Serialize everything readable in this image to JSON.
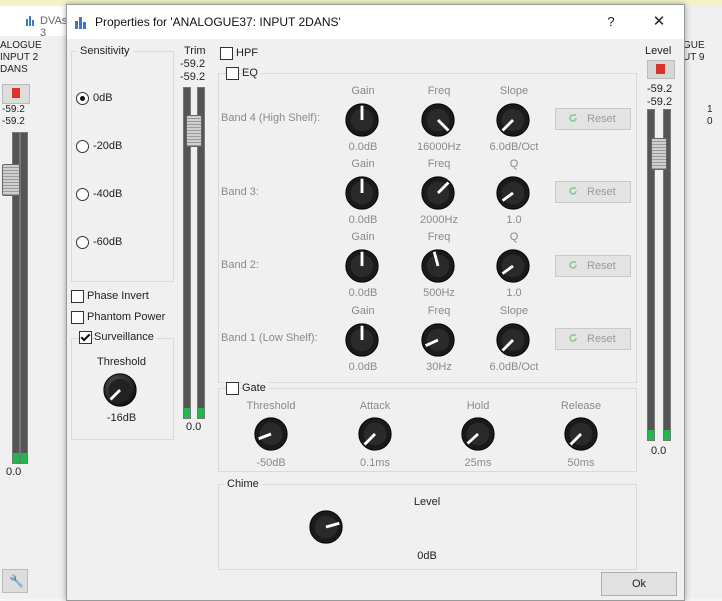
{
  "background": {
    "left_window": {
      "title": "DVAs 3",
      "name_lines": [
        "ALOGUE",
        "INPUT 2",
        "DANS"
      ],
      "values": [
        "-59.2",
        "-59.2"
      ],
      "bottom_value": "0.0"
    },
    "right_window": {
      "name_lines": [
        "GUE",
        "UT 9"
      ],
      "values": [
        "1",
        "0"
      ]
    }
  },
  "dialog": {
    "title": "Properties for 'ANALOGUE37: INPUT 2DANS'",
    "help_label": "?",
    "close_label": "✕",
    "ok_label": "Ok"
  },
  "sensitivity": {
    "label": "Sensitivity",
    "options": [
      "0dB",
      "-20dB",
      "-40dB",
      "-60dB"
    ],
    "selected": "0dB"
  },
  "options": {
    "phase_invert": {
      "label": "Phase Invert",
      "checked": false
    },
    "phantom_power": {
      "label": "Phantom Power",
      "checked": false
    },
    "surveillance": {
      "label": "Surveillance",
      "checked": true
    }
  },
  "threshold": {
    "label": "Threshold",
    "value": "-16dB"
  },
  "trim": {
    "label": "Trim",
    "values": [
      "-59.2",
      "-59.2"
    ],
    "bottom_value": "0.0"
  },
  "level": {
    "label": "Level",
    "values": [
      "-59.2",
      "-59.2"
    ],
    "bottom_value": "0.0"
  },
  "hpf": {
    "label": "HPF",
    "checked": false
  },
  "eq": {
    "label": "EQ",
    "checked": false,
    "reset_label": "Reset",
    "bands": [
      {
        "name": "Band 4 (High Shelf):",
        "p1": "Gain",
        "v1": "0.0dB",
        "p2": "Freq",
        "v2": "16000Hz",
        "p3": "Slope",
        "v3": "6.0dB/Oct"
      },
      {
        "name": "Band 3:",
        "p1": "Gain",
        "v1": "0.0dB",
        "p2": "Freq",
        "v2": "2000Hz",
        "p3": "Q",
        "v3": "1.0"
      },
      {
        "name": "Band 2:",
        "p1": "Gain",
        "v1": "0.0dB",
        "p2": "Freq",
        "v2": "500Hz",
        "p3": "Q",
        "v3": "1.0"
      },
      {
        "name": "Band 1 (Low Shelf):",
        "p1": "Gain",
        "v1": "0.0dB",
        "p2": "Freq",
        "v2": "30Hz",
        "p3": "Slope",
        "v3": "6.0dB/Oct"
      }
    ]
  },
  "gate": {
    "label": "Gate",
    "checked": false,
    "params": [
      {
        "label": "Threshold",
        "value": "-50dB"
      },
      {
        "label": "Attack",
        "value": "0.1ms"
      },
      {
        "label": "Hold",
        "value": "25ms"
      },
      {
        "label": "Release",
        "value": "50ms"
      }
    ]
  },
  "chime": {
    "label": "Chime",
    "level_label": "Level",
    "level_value": "0dB"
  },
  "colors": {
    "meter_green": "#1fb84d",
    "title_icon_blue": "#3a78c9",
    "mute_red": "#d9342b"
  }
}
